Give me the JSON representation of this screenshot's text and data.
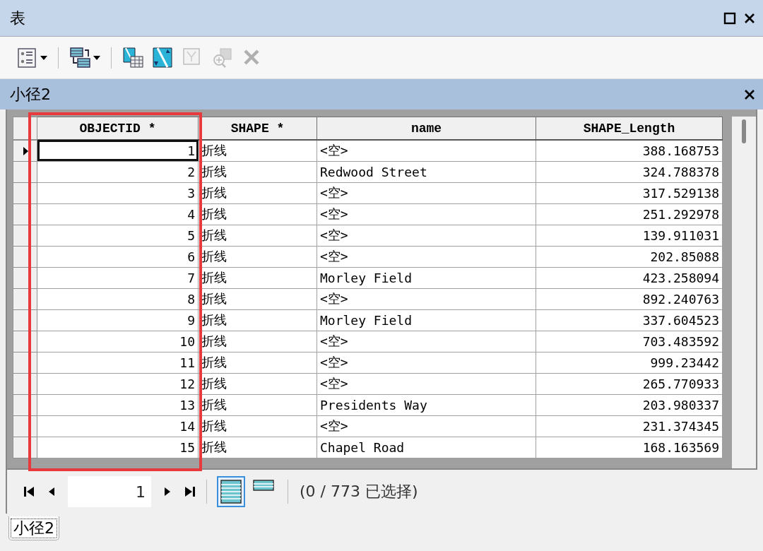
{
  "window": {
    "title": "表"
  },
  "toolbar": [
    {
      "disabled": false,
      "dropdown": true
    },
    {
      "disabled": false,
      "dropdown": true
    },
    {
      "disabled": false,
      "dropdown": false
    },
    {
      "disabled": false,
      "dropdown": false
    },
    {
      "disabled": true,
      "dropdown": false
    },
    {
      "disabled": true,
      "dropdown": false
    },
    {
      "disabled": true,
      "dropdown": false
    }
  ],
  "table": {
    "title": "小径2",
    "columns": [
      {
        "label": "OBJECTID *",
        "kind": "number",
        "highlighted": true
      },
      {
        "label": "SHAPE *",
        "kind": "text",
        "highlighted": false
      },
      {
        "label": "name",
        "kind": "text",
        "highlighted": false
      },
      {
        "label": "SHAPE_Length",
        "kind": "number",
        "highlighted": false
      }
    ],
    "rows": [
      {
        "cells": [
          "1",
          "折线",
          "<空>",
          "388.168753"
        ],
        "current": true
      },
      {
        "cells": [
          "2",
          "折线",
          "Redwood Street",
          "324.788378"
        ],
        "current": false
      },
      {
        "cells": [
          "3",
          "折线",
          "<空>",
          "317.529138"
        ],
        "current": false
      },
      {
        "cells": [
          "4",
          "折线",
          "<空>",
          "251.292978"
        ],
        "current": false
      },
      {
        "cells": [
          "5",
          "折线",
          "<空>",
          "139.911031"
        ],
        "current": false
      },
      {
        "cells": [
          "6",
          "折线",
          "<空>",
          "202.85088"
        ],
        "current": false
      },
      {
        "cells": [
          "7",
          "折线",
          "Morley Field",
          "423.258094"
        ],
        "current": false
      },
      {
        "cells": [
          "8",
          "折线",
          "<空>",
          "892.240763"
        ],
        "current": false
      },
      {
        "cells": [
          "9",
          "折线",
          "Morley Field",
          "337.604523"
        ],
        "current": false
      },
      {
        "cells": [
          "10",
          "折线",
          "<空>",
          "703.483592"
        ],
        "current": false
      },
      {
        "cells": [
          "11",
          "折线",
          "<空>",
          "999.23442"
        ],
        "current": false
      },
      {
        "cells": [
          "12",
          "折线",
          "<空>",
          "265.770933"
        ],
        "current": false
      },
      {
        "cells": [
          "13",
          "折线",
          "Presidents Way",
          "203.980337"
        ],
        "current": false
      },
      {
        "cells": [
          "14",
          "折线",
          "<空>",
          "231.374345"
        ],
        "current": false
      },
      {
        "cells": [
          "15",
          "折线",
          "Chapel Road",
          "168.163569"
        ],
        "current": false
      }
    ]
  },
  "navigator": {
    "page": "1",
    "status": "(0 / 773 已选择)",
    "views": [
      {
        "selected": true
      },
      {
        "selected": false
      }
    ]
  },
  "tabs": [
    {
      "label": "小径2",
      "selected": true
    }
  ]
}
